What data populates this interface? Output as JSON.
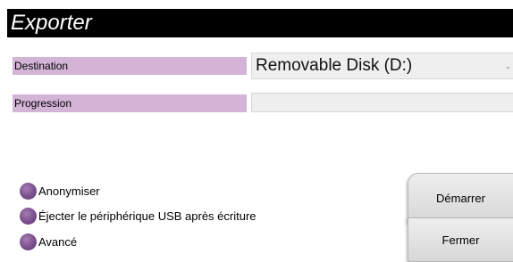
{
  "window": {
    "title": "Exporter"
  },
  "destination": {
    "label": "Destination",
    "selected": "Removable Disk (D:)"
  },
  "progress": {
    "label": "Progression",
    "value": 0
  },
  "options": [
    {
      "label": "Anonymiser"
    },
    {
      "label": "Éjecter le périphérique USB après écriture"
    },
    {
      "label": "Avancé"
    }
  ],
  "buttons": {
    "start": "Démarrer",
    "close": "Fermer"
  },
  "colors": {
    "label_bg": "#d3b4d6",
    "radio": "#7a4f8c",
    "titlebar": "#000000"
  }
}
